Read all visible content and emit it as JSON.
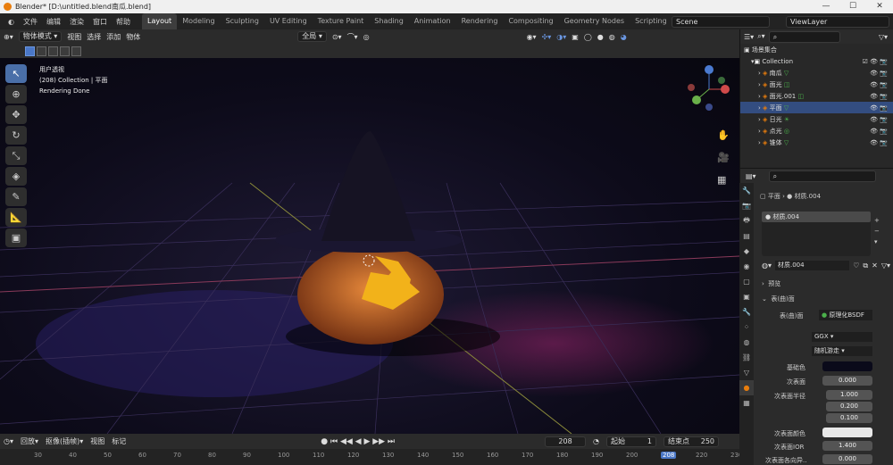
{
  "window": {
    "title": "Blender* [D:\\untitled.blend南瓜.blend]",
    "controls": [
      "—",
      "☐",
      "✕"
    ]
  },
  "menu": [
    "文件",
    "编辑",
    "渲染",
    "窗口",
    "帮助"
  ],
  "workspaces": [
    "Layout",
    "Modeling",
    "Sculpting",
    "UV Editing",
    "Texture Paint",
    "Shading",
    "Animation",
    "Rendering",
    "Compositing",
    "Geometry Nodes",
    "Scripting",
    "+"
  ],
  "scene": "Scene",
  "viewlayer": "ViewLayer",
  "toolbar": {
    "mode": "物体模式",
    "view": "视图",
    "select": "选择",
    "add": "添加",
    "object": "物体",
    "orient": "全局"
  },
  "viewport": {
    "line1": "用户透视",
    "line2": "(208) Collection | 平面",
    "line3": "Rendering Done",
    "colors": {
      "hat": "#161323",
      "pumpkin": "#d9762a",
      "face": "#f2b21a"
    }
  },
  "outliner": {
    "root": "场景集合",
    "collection": "Collection",
    "items": [
      {
        "name": "南瓜",
        "icon": "mesh-icon"
      },
      {
        "name": "面光",
        "icon": "light-icon"
      },
      {
        "name": "面光.001",
        "icon": "light-icon"
      },
      {
        "name": "平面",
        "icon": "mesh-icon",
        "selected": true
      },
      {
        "name": "日光",
        "icon": "sun-icon"
      },
      {
        "name": "点光",
        "icon": "point-light-icon"
      },
      {
        "name": "锥体",
        "icon": "mesh-icon"
      }
    ]
  },
  "properties": {
    "breadcrumb_obj": "平面",
    "breadcrumb_mat": "材质.004",
    "slot": "材质.004",
    "material": "材质.004",
    "preview": "预览",
    "surface": "表(曲)面",
    "surface_label": "表(曲)面",
    "shader": "原理化BSDF",
    "distribution": "GGX",
    "subsurface_method": "随机游走",
    "base_color_label": "基础色",
    "base_color": "#0a0a1a",
    "subsurface_label": "次表面",
    "subsurface": "0.000",
    "radius_label": "次表面半径",
    "radius": [
      "1.000",
      "0.200",
      "0.100"
    ],
    "subcolor_label": "次表面颜色",
    "subior_label": "次表面IOR",
    "subior": "1.400",
    "aniso_label": "次表面各向异..",
    "aniso": "0.000"
  },
  "timeline": {
    "playback": "回放",
    "keying": "抠像(插帧)",
    "view": "视图",
    "marker": "标记",
    "current": "208",
    "start_label": "起始",
    "start": "1",
    "end_label": "结束点",
    "end": "250",
    "ticks": [
      "30",
      "40",
      "50",
      "60",
      "70",
      "80",
      "90",
      "100",
      "110",
      "120",
      "130",
      "140",
      "150",
      "160",
      "170",
      "180",
      "190",
      "200",
      "208",
      "220",
      "230"
    ]
  }
}
